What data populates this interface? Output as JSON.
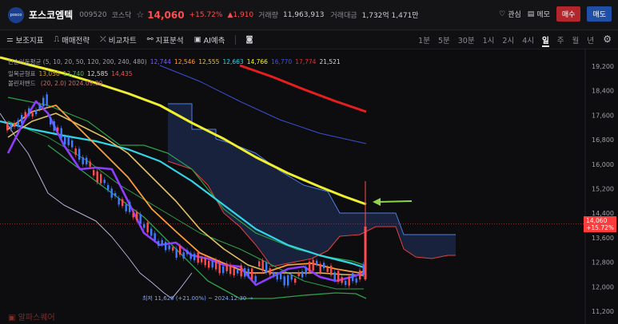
{
  "header": {
    "logo_text": "posco",
    "name": "포스코엠텍",
    "code": "009520",
    "market": "코스닥",
    "price": "14,060",
    "change_pct": "+15.72%",
    "change_amt": "▲1,910",
    "volume_label": "거래량",
    "volume": "11,963,913",
    "amount_label": "거래대금",
    "amount": "1,732억 1,471만",
    "interest": "관심",
    "memo": "메모",
    "buy": "매수",
    "sell": "매도"
  },
  "toolbar": {
    "items": [
      "보조지표",
      "매매전략",
      "비교차트",
      "지표분석",
      "AI예측"
    ],
    "periods": [
      "1분",
      "5분",
      "30분",
      "1시",
      "2시",
      "4시",
      "일",
      "주",
      "월",
      "년"
    ],
    "active_period": "일"
  },
  "legend": {
    "ma_label": "단순이동평균 (5, 10, 20, 50, 120, 200, 240, 480)",
    "ma_values": [
      {
        "v": "12,744",
        "c": "#7b5cff"
      },
      {
        "v": "12,546",
        "c": "#ff9c3a"
      },
      {
        "v": "12,555",
        "c": "#e0c060"
      },
      {
        "v": "12,663",
        "c": "#33d6e6"
      },
      {
        "v": "14,766",
        "c": "#f4f430"
      },
      {
        "v": "16,770",
        "c": "#3f55d8"
      },
      {
        "v": "17,774",
        "c": "#e03030"
      },
      {
        "v": "21,521",
        "c": "#d9d9d9"
      }
    ],
    "ichimoku_label": "일목균형표",
    "ichimoku_values": [
      {
        "v": "13,050",
        "c": "#cfa030"
      },
      {
        "v": "13,740",
        "c": "#4fb050"
      },
      {
        "v": "12,585",
        "c": "#d9d9d9"
      },
      {
        "v": "14,435",
        "c": "#ff5050"
      }
    ],
    "bollinger_label": "볼린저밴드",
    "bollinger_values": "(20, 2.0) 2024.09.30"
  },
  "axis": {
    "ticks": [
      "19,200",
      "18,400",
      "17,600",
      "16,800",
      "16,000",
      "15,200",
      "14,400",
      "13,600",
      "12,800",
      "12,000",
      "11,200"
    ]
  },
  "current_price_tag": {
    "price": "14,060",
    "pct": "+15.72%"
  },
  "lowest_label": "최저 11,620 (+21.00%) ~ 2024.12.30 →",
  "watermark": "알파스퀘어",
  "colors": {
    "up": "#ff4d4f",
    "down": "#3d7bff",
    "accent_arrow": "#8fd44a"
  }
}
